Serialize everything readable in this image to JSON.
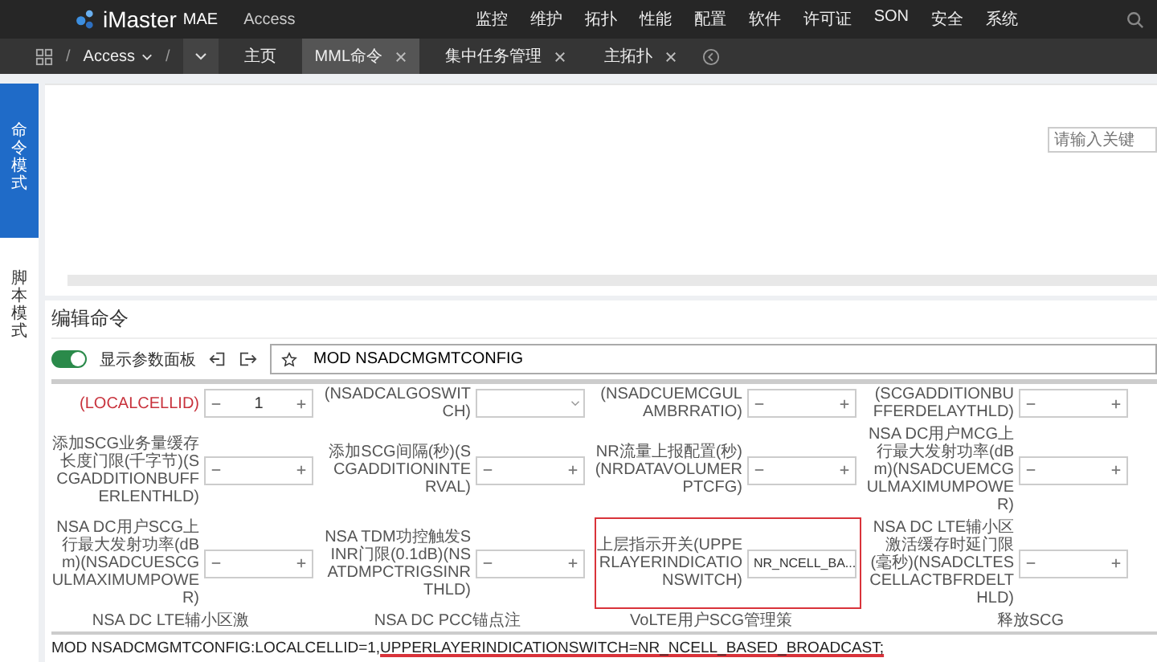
{
  "top_nav": {
    "brand": "iMaster",
    "brand_suffix": "MAE",
    "context": "Access",
    "menu": [
      "监控",
      "维护",
      "拓扑",
      "性能",
      "配置",
      "软件",
      "许可证",
      "SON",
      "安全",
      "系统"
    ]
  },
  "tab_bar": {
    "breadcrumb": [
      {
        "kind": "sep",
        "text": "/"
      },
      {
        "kind": "item",
        "text": "Access"
      },
      {
        "kind": "sep",
        "text": "/"
      }
    ],
    "tabs": [
      {
        "label": "主页",
        "selected": false,
        "closable": false
      },
      {
        "label": "MML命令",
        "selected": true,
        "closable": true
      },
      {
        "label": "集中任务管理",
        "selected": false,
        "closable": true
      },
      {
        "label": "主拓扑",
        "selected": false,
        "closable": true
      }
    ]
  },
  "side_tabs": [
    {
      "label": "命令模式",
      "selected": true
    },
    {
      "label": "脚本模式",
      "selected": false
    }
  ],
  "results_panel": {
    "search": {
      "placeholder": "请输入关键"
    }
  },
  "editor": {
    "title": "编辑命令",
    "show_panel": {
      "label": "显示参数面板",
      "on": true
    },
    "command_input": "MOD NSADCMGMTCONFIG",
    "params": [
      {
        "label": "(LOCALCELLID)",
        "required": true,
        "kind": "number",
        "value": "1",
        "highlighted": false
      },
      {
        "label": "(NSADCALGOSWITCH)",
        "required": false,
        "kind": "select",
        "highlighted": false
      },
      {
        "label": "(NSADCUEMCGULAMBRRATIO)",
        "required": false,
        "kind": "number",
        "highlighted": false
      },
      {
        "label": "(SCGADDITIONBUFFERDELAYTHLD)",
        "required": false,
        "kind": "number",
        "highlighted": false
      },
      {
        "label": "添加SCG业务量缓存长度门限(千字节)(SCGADDITIONBUFFERLENTHLD)",
        "required": false,
        "kind": "number",
        "highlighted": false
      },
      {
        "label": "添加SCG间隔(秒)(SCGADDITIONINTERVAL)",
        "required": false,
        "kind": "number",
        "highlighted": false
      },
      {
        "label": "NR流量上报配置(秒)(NRDATAVOLUMERPTCFG)",
        "required": false,
        "kind": "number",
        "highlighted": false
      },
      {
        "label": "NSA DC用户MCG上行最大发射功率(dBm)(NSADCUEMCGULMAXIMUMPOWER)",
        "required": false,
        "kind": "number",
        "highlighted": false
      },
      {
        "label": "NSA DC用户SCG上行最大发射功率(dBm)(NSADCUESCGULMAXIMUMPOWER)",
        "required": false,
        "kind": "number",
        "highlighted": false
      },
      {
        "label": "NSA TDM功控触发SINR门限(0.1dB)(NSATDMPCTRIGSINRTHLD)",
        "required": false,
        "kind": "number",
        "highlighted": false
      },
      {
        "label": "上层指示开关(UPPERLAYERINDICATIONSWITCH)",
        "required": false,
        "kind": "select",
        "value": "NR_NCELL_BA...",
        "highlighted": true
      },
      {
        "label": "NSA DC LTE辅小区激活缓存时延门限(毫秒)(NSADCLTESCELLACTBFRDELTHLD)",
        "required": false,
        "kind": "number",
        "highlighted": false
      }
    ],
    "cut_labels": [
      "NSA DC LTE辅小区激",
      "NSA DC PCC锚点注",
      "VoLTE用户SCG管理策",
      "释放SCG"
    ],
    "command_text": {
      "prefix": "MOD NSADCMGMTCONFIG:LOCALCELLID=1,",
      "underlined": "UPPERLAYERINDICATIONSWITCH=NR_NCELL_BASED_BROADCAST;"
    }
  }
}
